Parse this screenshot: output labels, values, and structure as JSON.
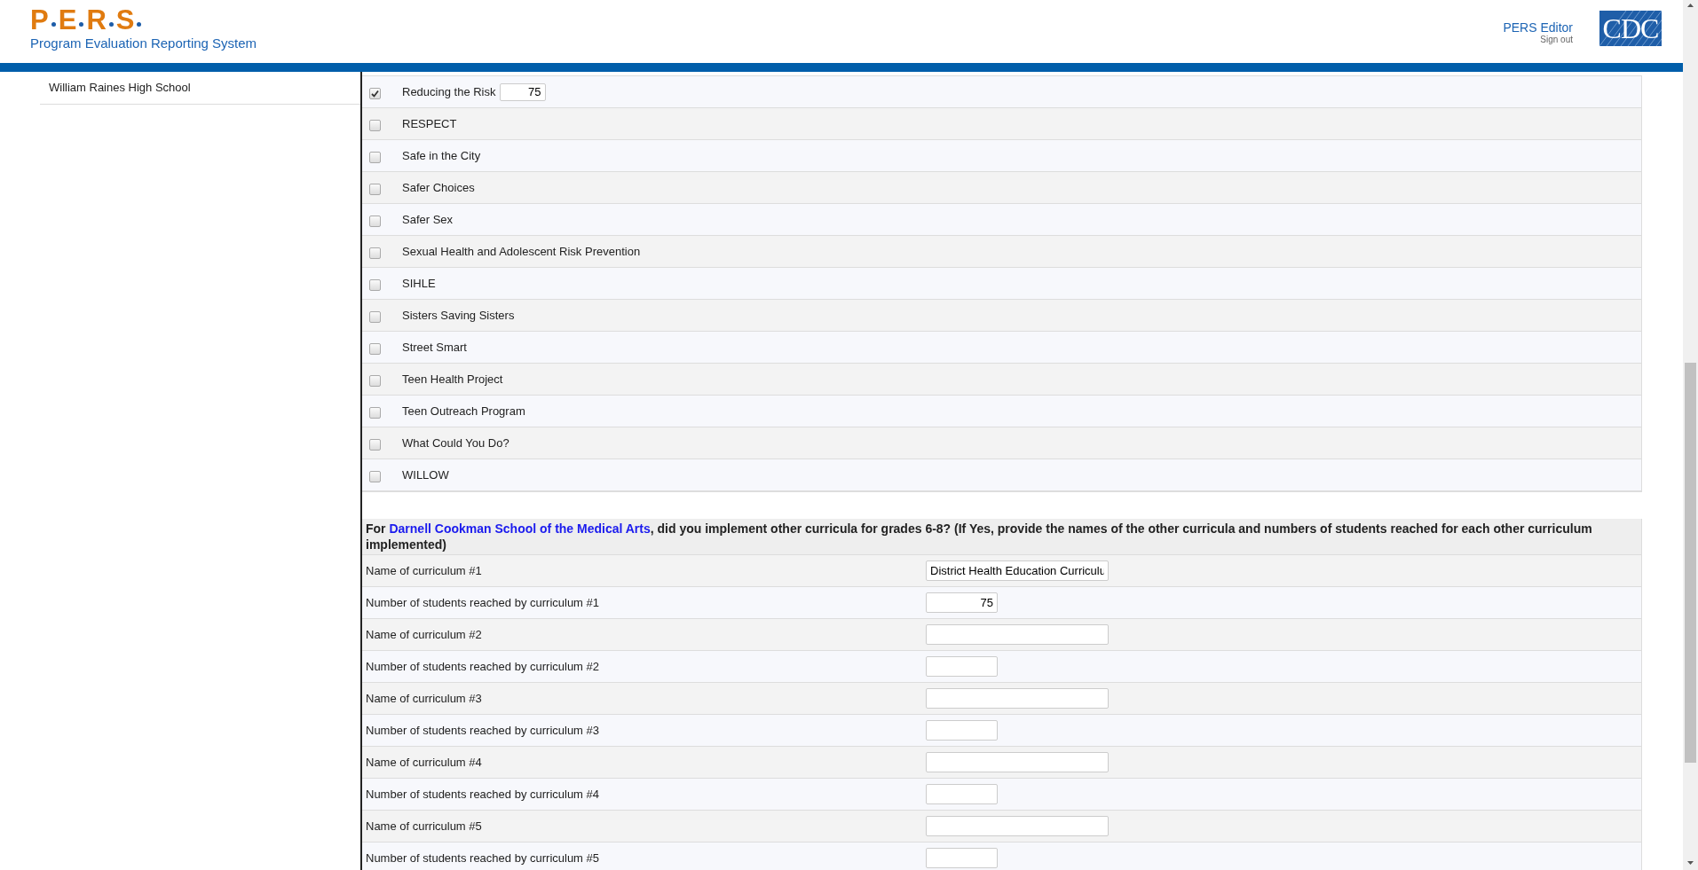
{
  "header": {
    "logo_letters": [
      "P",
      "E",
      "R",
      "S"
    ],
    "subtitle": "Program Evaluation Reporting System",
    "user_link": "PERS Editor",
    "sign_out": "Sign out",
    "agency_logo": "CDC"
  },
  "sidebar": {
    "items": [
      {
        "label": "William Raines High School",
        "selected": false
      }
    ]
  },
  "programs": [
    {
      "label": "Reducing the Risk",
      "checked": true,
      "value": "75"
    },
    {
      "label": "RESPECT",
      "checked": false
    },
    {
      "label": "Safe in the City",
      "checked": false
    },
    {
      "label": "Safer Choices",
      "checked": false
    },
    {
      "label": "Safer Sex",
      "checked": false
    },
    {
      "label": "Sexual Health and Adolescent Risk Prevention",
      "checked": false
    },
    {
      "label": "SIHLE",
      "checked": false
    },
    {
      "label": "Sisters Saving Sisters",
      "checked": false
    },
    {
      "label": "Street Smart",
      "checked": false
    },
    {
      "label": "Teen Health Project",
      "checked": false
    },
    {
      "label": "Teen Outreach Program",
      "checked": false
    },
    {
      "label": "What Could You Do?",
      "checked": false
    },
    {
      "label": "WILLOW",
      "checked": false
    }
  ],
  "question": {
    "prefix": "For ",
    "school": "Darnell Cookman School of the Medical Arts",
    "suffix": ", did you implement other curricula for grades 6-8? (If Yes, provide the names of the other curricula and numbers of students reached for each other curriculum implemented)",
    "fields": [
      {
        "label": "Name of curriculum #1",
        "kind": "name",
        "value": "District Health Education Curriculu"
      },
      {
        "label": "Number of students reached by curriculum #1",
        "kind": "number",
        "value": "75"
      },
      {
        "label": "Name of curriculum #2",
        "kind": "name"
      },
      {
        "label": "Number of students reached by curriculum #2",
        "kind": "number"
      },
      {
        "label": "Name of curriculum #3",
        "kind": "name"
      },
      {
        "label": "Number of students reached by curriculum #3",
        "kind": "number"
      },
      {
        "label": "Name of curriculum #4",
        "kind": "name"
      },
      {
        "label": "Number of students reached by curriculum #4",
        "kind": "number"
      },
      {
        "label": "Name of curriculum #5",
        "kind": "name"
      },
      {
        "label": "Number of students reached by curriculum #5",
        "kind": "number"
      }
    ]
  }
}
